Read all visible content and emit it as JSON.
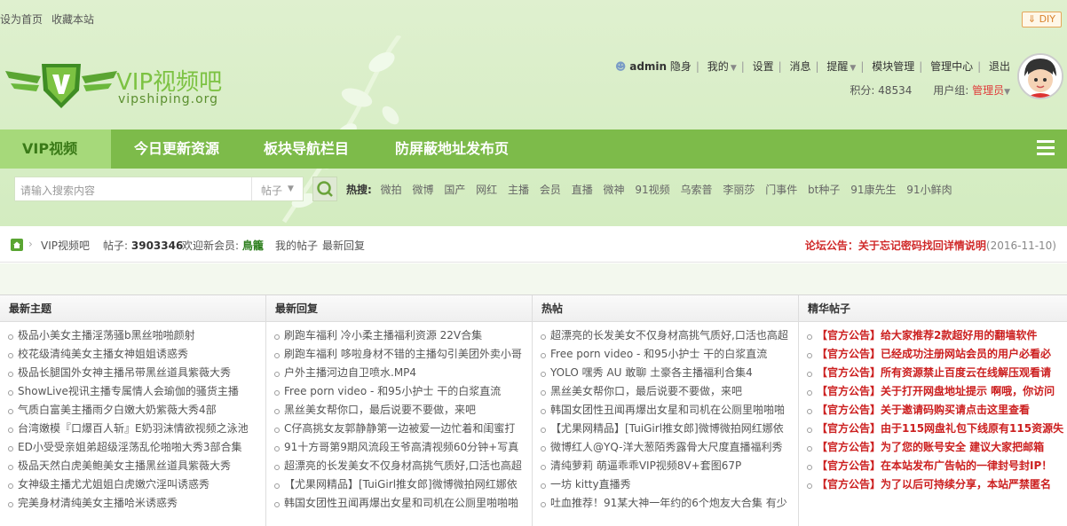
{
  "topbar": {
    "set_home": "设为首页",
    "bookmark": "收藏本站",
    "diy": "DIY"
  },
  "logo": {
    "title": "VIP视频吧",
    "subtitle": "vipshiping.org"
  },
  "user": {
    "name": "admin",
    "invisible": "隐身",
    "my": "我的",
    "settings": "设置",
    "messages": "消息",
    "reminders": "提醒",
    "module_admin": "模块管理",
    "admin_center": "管理中心",
    "logout": "退出",
    "points": "积分: 48534",
    "group_label": "用户组:",
    "group": "管理员"
  },
  "nav": {
    "items": [
      {
        "label": "VIP视频吧"
      },
      {
        "label": "今日更新资源"
      },
      {
        "label": "板块导航栏目"
      },
      {
        "label": "防屏蔽地址发布页"
      }
    ]
  },
  "search": {
    "placeholder": "请输入搜索内容",
    "scope": "帖子",
    "hot_label": "热搜:",
    "hot_words": [
      "微拍",
      "微博",
      "国产",
      "网红",
      "主播",
      "会员",
      "直播",
      "微神",
      "91视频",
      "乌索普",
      "李丽莎",
      "门事件",
      "bt种子",
      "91康先生",
      "91小鲜肉"
    ]
  },
  "crumb": {
    "home": "VIP视频吧",
    "posts_label": "帖子:",
    "posts_count": "3903346",
    "welcome": "欢迎新会员:",
    "new_member": "鳥籠",
    "my_posts": "我的帖子",
    "latest_replies": "最新回复",
    "notice_title": "论坛公告：关于忘记密码找回详情说明",
    "notice_date": "(2016-11-10)"
  },
  "columns": [
    {
      "title": "最新主题",
      "items": [
        "极品小美女主播淫荡骚b黑丝啪啪颜射",
        "校花级清纯美女主播女神姐姐诱惑秀",
        "极品长腿国外女神主播吊带黑丝道具紫薇大秀",
        "ShowLive视讯主播专属情人会瑜伽的骚货主播",
        "气质白富美主播雨夕白嫩大奶紫薇大秀4部",
        "台湾嫩模『口爆百人斩』E奶羽沫情欲视频之泳池",
        "ED小受受亲姐弟超级淫荡乱伦啪啪大秀3部合集",
        "极品天然白虎美鲍美女主播黑丝道具紫薇大秀",
        "女神级主播尤尤姐姐白虎嫩穴淫叫诱惑秀",
        "完美身材清纯美女主播哈米诱惑秀"
      ]
    },
    {
      "title": "最新回复",
      "items": [
        "刷跑车福利 冷小柔主播福利资源 22V合集",
        "刷跑车福利 哆啦身材不错的主播勾引美团外卖小哥",
        "户外主播河边自卫喷水.MP4",
        "Free porn video - 和95小护士 干的白浆直流",
        "黑丝美女帮你口，最后说要不要做，来吧",
        "C仔高挑女友郭静静第一边被爱一边忙着和闺蜜打",
        "91十方哥第9期风流段王爷高清视频60分钟+写真",
        "超漂亮的长发美女不仅身材高挑气质好,口活也高超",
        "【尤果网精品】[TuiGirl推女郎]微博微拍网红娜依",
        "韩国女团性丑闻再爆出女星和司机在公厕里啪啪啪"
      ]
    },
    {
      "title": "热帖",
      "items": [
        "超漂亮的长发美女不仅身材高挑气质好,口活也高超",
        "Free porn video - 和95小护士 干的白浆直流",
        "YOLO 嘿秀 AU 敢聊 土豪各主播福利合集4",
        "黑丝美女帮你口，最后说要不要做，来吧",
        "韩国女团性丑闻再爆出女星和司机在公厕里啪啪啪",
        "【尤果网精品】[TuiGirl推女郎]微博微拍网红娜依",
        "微博红人@YQ-洋大葱陌秀露骨大尺度直播福利秀",
        "清纯萝莉 萌逼乖乖VIP视频8V+套图67P",
        "一坊 kitty直播秀",
        "吐血推荐！91某大神一年约的6个炮友大合集 有少"
      ]
    },
    {
      "title": "精华帖子",
      "items": [
        "【官方公告】给大家推荐2款超好用的翻墙软件",
        "【官方公告】已经成功注册网站会员的用户必看必",
        "【官方公告】所有资源禁止百度云在线解压观看请",
        "【官方公告】关于打开网盘地址提示 啊哦，你访问",
        "【官方公告】关于邀请码购买请点击这里查看",
        "【官方公告】由于115网盘礼包下线原有115资源失",
        "【官方公告】为了您的账号安全 建议大家把邮箱",
        "【官方公告】在本站发布广告帖的一律封号封IP！",
        "【官方公告】为了以后可持续分享，本站严禁匿名"
      ]
    }
  ],
  "colors": {
    "nav_bg": "#7dbb4a",
    "accent_red": "#cc1f1f",
    "bg_green": "#d8eec6"
  }
}
